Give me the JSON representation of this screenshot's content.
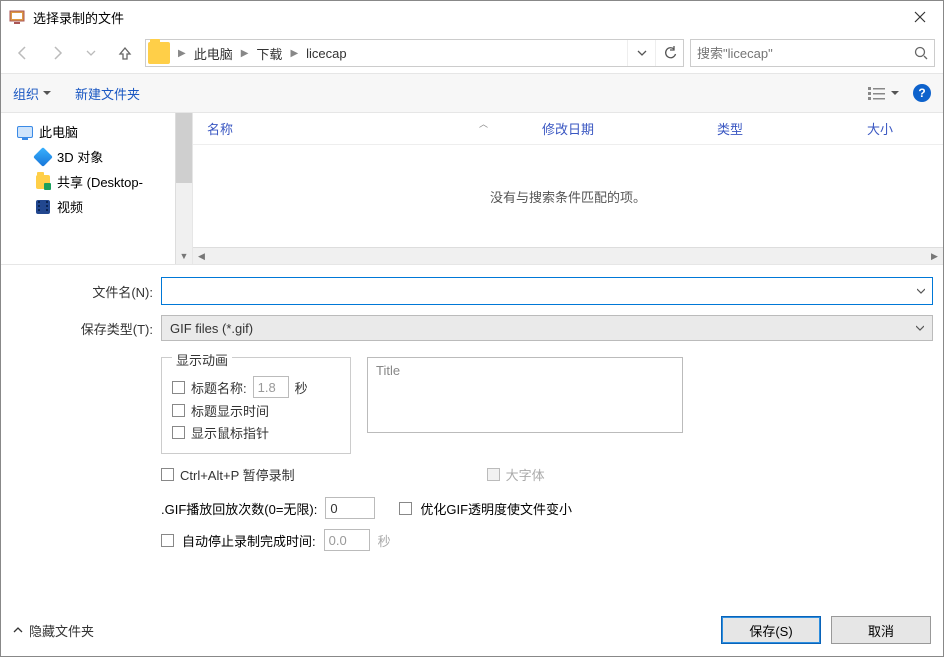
{
  "window": {
    "title": "选择录制的文件"
  },
  "breadcrumb": {
    "seg1": "此电脑",
    "seg2": "下载",
    "seg3": "licecap"
  },
  "search": {
    "placeholder": "搜索\"licecap\""
  },
  "toolbar": {
    "organize": "组织",
    "newfolder": "新建文件夹"
  },
  "columns": {
    "name": "名称",
    "date": "修改日期",
    "type": "类型",
    "size": "大小"
  },
  "list": {
    "empty": "没有与搜索条件匹配的项。"
  },
  "tree": {
    "root": "此电脑",
    "item1": "3D 对象",
    "item2": "共享 (Desktop-",
    "item3": "视频"
  },
  "fields": {
    "filename_label": "文件名(N):",
    "filename_value": "",
    "type_label": "保存类型(T):",
    "type_value": "GIF files (*.gif)"
  },
  "opts": {
    "anim_legend": "显示动画",
    "title_name": "标题名称:",
    "title_name_val": "1.8",
    "sec": "秒",
    "title_time": "标题显示时间",
    "show_cursor": "显示鼠标指针",
    "title_placeholder": "Title",
    "pause_hotkey": "Ctrl+Alt+P 暂停录制",
    "bigfont": "大字体",
    "loop_label": ".GIF播放回放次数(0=无限):",
    "loop_val": "0",
    "optimize": "优化GIF透明度使文件变小",
    "autostop": "自动停止录制完成时间:",
    "autostop_val": "0.0",
    "autostop_sec": "秒"
  },
  "footer": {
    "hide": "隐藏文件夹",
    "save": "保存(S)",
    "cancel": "取消"
  }
}
